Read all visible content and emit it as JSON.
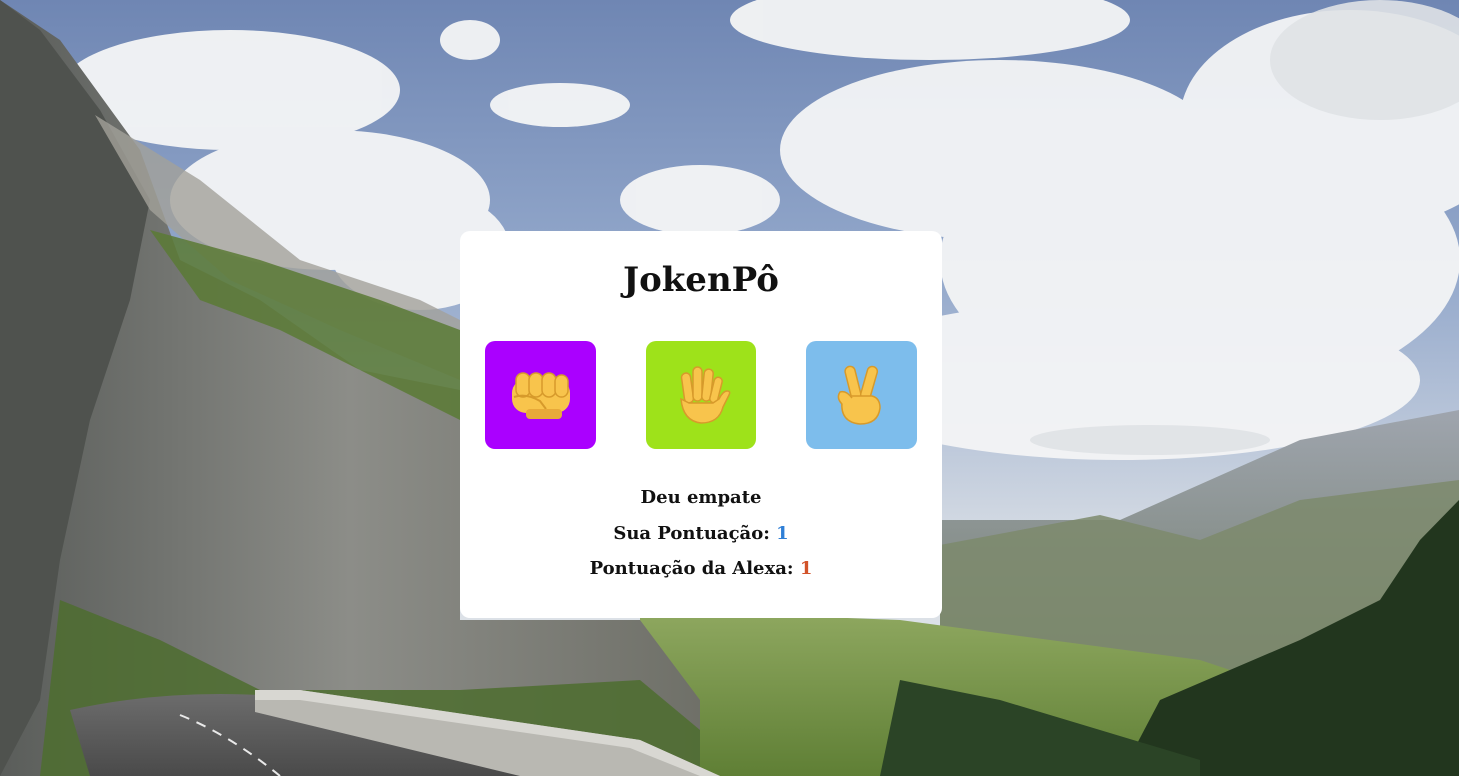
{
  "colors": {
    "card_background": "#ffffff",
    "rock_button": "#aa00ff",
    "paper_button": "#9ee21a",
    "scissors_button": "#7dbdec",
    "player_score": "#2f7fd6",
    "alexa_score": "#d2532a",
    "emoji_skin": "#f8c44c"
  },
  "game": {
    "title": "JokenPô",
    "choices": [
      {
        "id": "rock",
        "icon": "raised-fist-icon"
      },
      {
        "id": "paper",
        "icon": "raised-hand-icon"
      },
      {
        "id": "scissors",
        "icon": "victory-hand-icon"
      }
    ],
    "result_message": "Deu empate",
    "player_score_label": "Sua Pontuação:",
    "player_score": "1",
    "alexa_score_label": "Pontuação da Alexa:",
    "alexa_score": "1"
  }
}
